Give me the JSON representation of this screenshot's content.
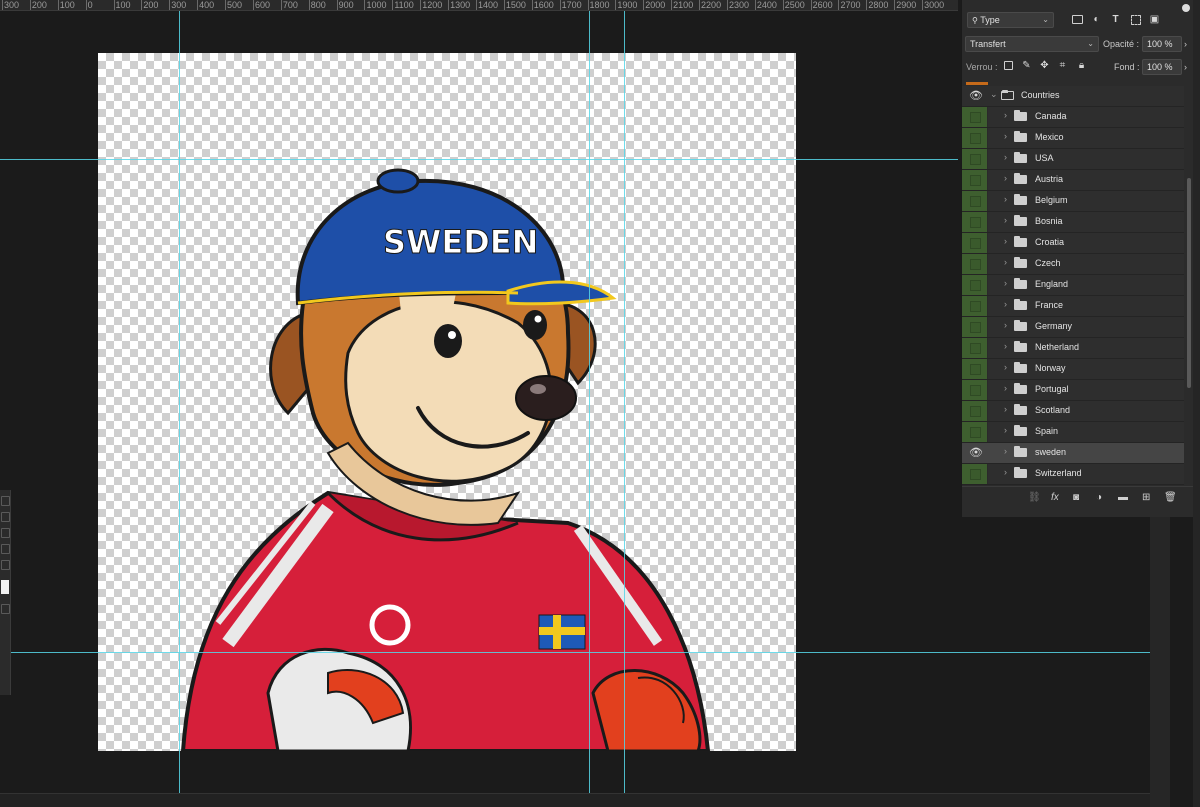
{
  "ruler": {
    "labels": [
      "300",
      "200",
      "100",
      "0",
      "100",
      "200",
      "300",
      "400",
      "500",
      "600",
      "700",
      "800",
      "900",
      "1000",
      "1100",
      "1200",
      "1300",
      "1400",
      "1500",
      "1600",
      "1700",
      "1800",
      "1900",
      "2000",
      "2100",
      "2200",
      "2300",
      "2400",
      "2500",
      "2600",
      "2700",
      "2800",
      "2900",
      "3000"
    ]
  },
  "panel": {
    "filter": {
      "label": "Type",
      "icon": "search-icon"
    },
    "blend_mode": "Transfert",
    "opacity_label": "Opacité :",
    "opacity_value": "100 %",
    "lock_label": "Verrou :",
    "fill_label": "Fond :",
    "fill_value": "100 %",
    "group": {
      "name": "Countries",
      "visible": true
    },
    "layers": [
      {
        "name": "Canada",
        "visible": false,
        "selected": false
      },
      {
        "name": "Mexico",
        "visible": false,
        "selected": false
      },
      {
        "name": "USA",
        "visible": false,
        "selected": false
      },
      {
        "name": "Austria",
        "visible": false,
        "selected": false
      },
      {
        "name": "Belgium",
        "visible": false,
        "selected": false
      },
      {
        "name": "Bosnia",
        "visible": false,
        "selected": false
      },
      {
        "name": "Croatia",
        "visible": false,
        "selected": false
      },
      {
        "name": "Czech",
        "visible": false,
        "selected": false
      },
      {
        "name": "England",
        "visible": false,
        "selected": false
      },
      {
        "name": "France",
        "visible": false,
        "selected": false
      },
      {
        "name": "Germany",
        "visible": false,
        "selected": false
      },
      {
        "name": "Netherland",
        "visible": false,
        "selected": false
      },
      {
        "name": "Norway",
        "visible": false,
        "selected": false
      },
      {
        "name": "Portugal",
        "visible": false,
        "selected": false
      },
      {
        "name": "Scotland",
        "visible": false,
        "selected": false
      },
      {
        "name": "Spain",
        "visible": false,
        "selected": false
      },
      {
        "name": "sweden",
        "visible": true,
        "selected": true
      },
      {
        "name": "Switzerland",
        "visible": false,
        "selected": false
      }
    ],
    "footer_icons": [
      "link-icon",
      "fx-icon",
      "mask-icon",
      "adjustment-icon",
      "new-group-icon",
      "new-layer-icon",
      "trash-icon"
    ],
    "footer_fx": "fx"
  },
  "artwork": {
    "cap_text": "SWEDEN",
    "colors": {
      "cap": "#1e4fa8",
      "jersey": "#d61f3a",
      "fur": "#c9782f",
      "guide": "#56d6e8"
    }
  }
}
